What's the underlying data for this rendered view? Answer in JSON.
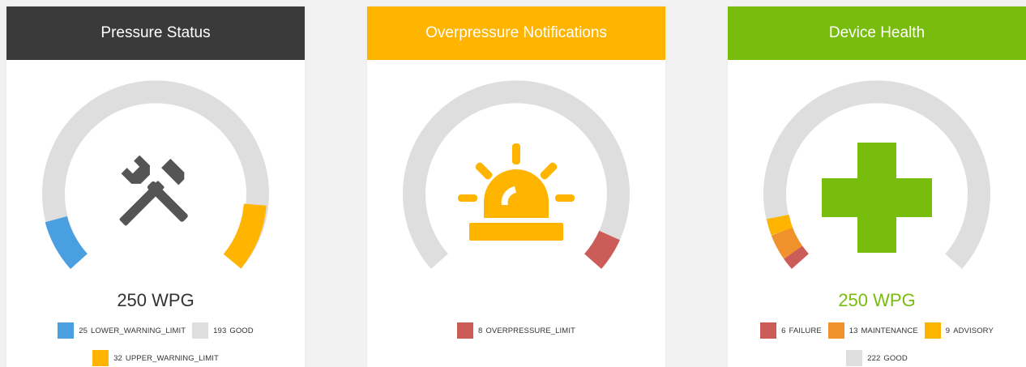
{
  "colors": {
    "dark_header": "#3a3a3a",
    "amber": "#ffb400",
    "green": "#78bd0d",
    "blue": "#4a9fe0",
    "red": "#cc5c57",
    "orange": "#f0912c",
    "track": "#dedede",
    "icon_gray": "#555555"
  },
  "cards": [
    {
      "title": "Pressure Status",
      "icon": "wrench-hammer-icon",
      "value": "250 WPG",
      "legend": [
        {
          "count": "25",
          "label": "LOWER_WARNING_LIMIT",
          "color": "#4a9fe0"
        },
        {
          "count": "193",
          "label": "GOOD",
          "color": "#dedede"
        },
        {
          "count": "32",
          "label": "UPPER_WARNING_LIMIT",
          "color": "#ffb400"
        }
      ]
    },
    {
      "title": "Overpressure Notifications",
      "icon": "alarm-siren-icon",
      "legend": [
        {
          "count": "8",
          "label": "OVERPRESSURE_LIMIT",
          "color": "#cc5c57"
        }
      ]
    },
    {
      "title": "Device Health",
      "icon": "health-cross-icon",
      "value": "250 WPG",
      "legend": [
        {
          "count": "6",
          "label": "FAILURE",
          "color": "#cc5c57"
        },
        {
          "count": "13",
          "label": "MAINTENANCE",
          "color": "#f0912c"
        },
        {
          "count": "9",
          "label": "ADVISORY",
          "color": "#ffb400"
        },
        {
          "count": "222",
          "label": "GOOD",
          "color": "#dedede"
        }
      ]
    }
  ]
}
